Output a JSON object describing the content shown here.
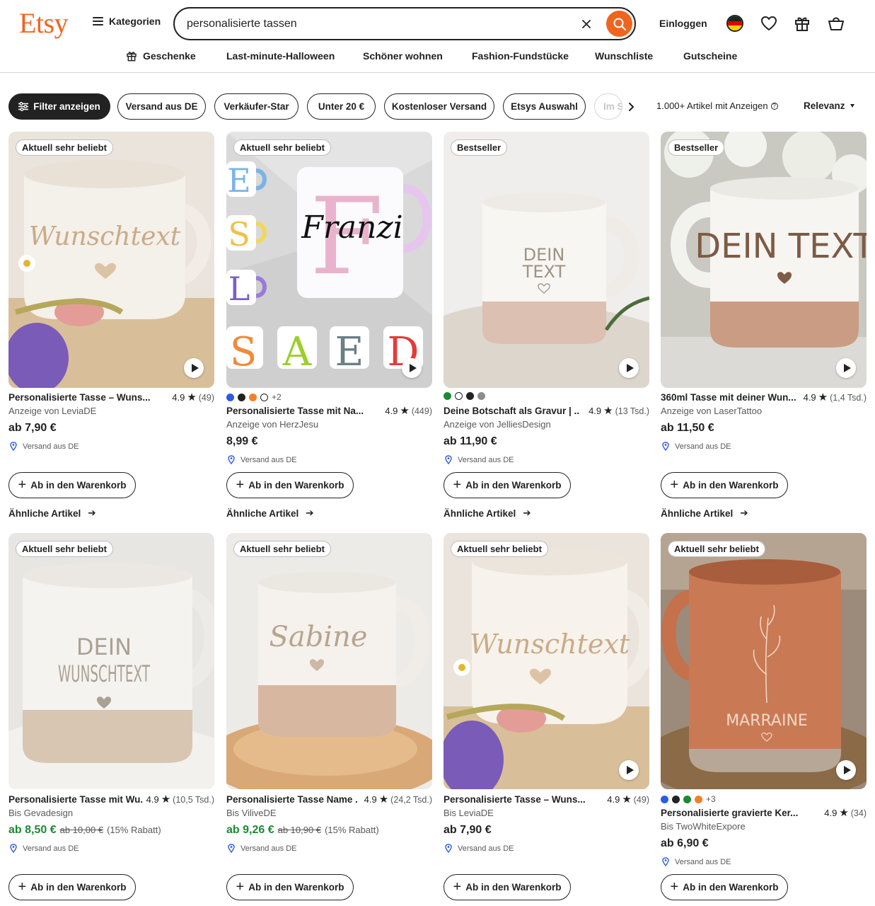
{
  "header": {
    "logo": "Etsy",
    "categories_label": "Kategorien",
    "search_value": "personalisierte tassen",
    "login_label": "Einloggen"
  },
  "nav": [
    {
      "label": "Geschenke",
      "icon": "gift-icon"
    },
    {
      "label": "Last-minute-Halloween"
    },
    {
      "label": "Schöner wohnen"
    },
    {
      "label": "Fashion-Fundstücke"
    },
    {
      "label": "Wunschliste"
    },
    {
      "label": "Gutscheine"
    }
  ],
  "filters": {
    "chips": [
      "Filter anzeigen",
      "Versand aus DE",
      "Verkäufer-Star",
      "Unter 20 €",
      "Kostenloser Versand",
      "Etsys Auswahl",
      "Im S"
    ],
    "results_count": "1.000+ Artikel",
    "results_suffix": "mit Anzeigen",
    "sort_label": "Relevanz"
  },
  "accent_color": "#f1641e",
  "sale_color": "#1b8a32",
  "cart_label": "Ab in den Warenkorb",
  "similar_label": "Ähnliche Artikel",
  "products": [
    {
      "badge": "Aktuell sehr beliebt",
      "title": "Personalisierte Tasse – Wuns...",
      "rating": "4.9",
      "reviews": "(49)",
      "seller": "Anzeige von LeviaDE",
      "price": "ab 7,90 €",
      "shipping": "Versand aus DE",
      "video": true,
      "image_text": "Wunschtext"
    },
    {
      "badge": "Aktuell sehr beliebt",
      "swatches": [
        "#2b5ce6",
        "#222222",
        "#f47f2a",
        "#ffffff"
      ],
      "swatch_more": "+2",
      "title": "Personalisierte Tasse mit Na...",
      "rating": "4.9",
      "reviews": "(449)",
      "seller": "Anzeige von HerzJesu",
      "price": "8,99 €",
      "shipping": "Versand aus DE",
      "video": true,
      "image_text": "Franzi",
      "image_letters": [
        "E",
        "S",
        "L",
        "S",
        "A",
        "E",
        "D"
      ]
    },
    {
      "badge": "Bestseller",
      "swatches": [
        "#1b8a32",
        "#ffffff",
        "#222222",
        "#8c8c8c"
      ],
      "title": "Deine Botschaft als Gravur | ...",
      "rating": "4.9",
      "reviews": "(13 Tsd.)",
      "seller": "Anzeige von JelliesDesign",
      "price": "ab 11,90 €",
      "shipping": "Versand aus DE",
      "video": true,
      "image_text": [
        "DEIN",
        "TEXT"
      ]
    },
    {
      "badge": "Bestseller",
      "title": "360ml Tasse mit deiner Wun...",
      "rating": "4.9",
      "reviews": "(1,4 Tsd.)",
      "seller": "Anzeige von LaserTattoo",
      "price": "ab 11,50 €",
      "shipping": "Versand aus DE",
      "video": true,
      "image_text": "DEIN TEXT"
    },
    {
      "badge": "Aktuell sehr beliebt",
      "title": "Personalisierte Tasse mit Wu...",
      "rating": "4.9",
      "reviews": "(10,5 Tsd.)",
      "seller": "Bis Gevadesign",
      "price": "ab 8,50 €",
      "old_price": "ab 10,00 €",
      "discount": "(15% Rabatt)",
      "shipping": "Versand aus DE",
      "video": false,
      "image_text": [
        "DEIN",
        "WUNSCHTEXT"
      ]
    },
    {
      "badge": "Aktuell sehr beliebt",
      "title": "Personalisierte Tasse Name ...",
      "rating": "4.9",
      "reviews": "(24,2 Tsd.)",
      "seller": "Bis ViliveDE",
      "price": "ab 9,26 €",
      "old_price": "ab 10,90 €",
      "discount": "(15% Rabatt)",
      "shipping": "Versand aus DE",
      "video": false,
      "image_text": "Sabine"
    },
    {
      "badge": "Aktuell sehr beliebt",
      "title": "Personalisierte Tasse – Wuns...",
      "rating": "4.9",
      "reviews": "(49)",
      "seller": "Bis LeviaDE",
      "price": "ab 7,90 €",
      "shipping": "Versand aus DE",
      "video": true,
      "image_text": "Wunschtext"
    },
    {
      "badge": "Aktuell sehr beliebt",
      "swatches": [
        "#2b5ce6",
        "#222222",
        "#1b8a32",
        "#f47f2a"
      ],
      "swatch_more": "+3",
      "title": "Personalisierte gravierte Ker...",
      "rating": "4.9",
      "reviews": "(34)",
      "seller": "Bis TwoWhiteExpore",
      "price": "ab 6,90 €",
      "shipping": "Versand aus DE",
      "video": true,
      "image_text": "MARRAINE"
    }
  ]
}
